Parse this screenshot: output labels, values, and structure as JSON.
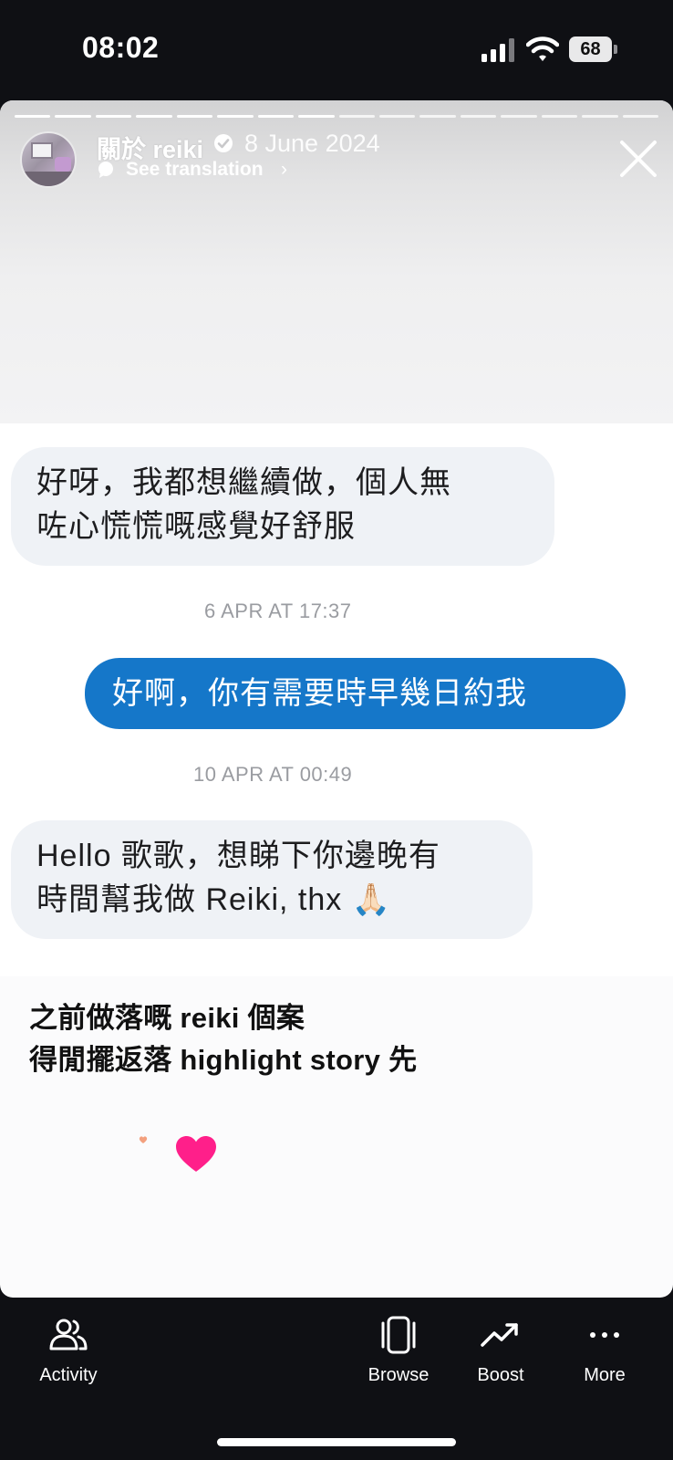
{
  "status_bar": {
    "time": "08:02",
    "battery": "68"
  },
  "story": {
    "account_name": "關於 reiki",
    "date": "8 June 2024",
    "see_translation": "See translation",
    "progress_total": 16,
    "progress_done": 8
  },
  "chat": {
    "messages": [
      {
        "direction": "incoming",
        "line1": "好呀，我都想繼續做，個人無",
        "line2": "咗心慌慌嘅感覺好舒服"
      },
      {
        "direction": "outgoing",
        "line1": "好啊，你有需要時早幾日約我"
      },
      {
        "direction": "incoming",
        "line1": "Hello 歌歌，想睇下你邊晚有",
        "line2": "時間幫我做 Reiki, thx 🙏🏻"
      }
    ],
    "timestamps": [
      "6 APR AT 17:37",
      "10 APR AT 00:49"
    ]
  },
  "caption": {
    "line1": "之前做落嘅 reiki 個案",
    "line2": "得閒擺返落 highlight story 先"
  },
  "bottom_nav": {
    "activity": "Activity",
    "browse": "Browse",
    "boost": "Boost",
    "more": "More"
  },
  "colors": {
    "outgoing_bubble": "#1577c9",
    "incoming_bubble": "#eff2f6",
    "heart": "#ff1f8a",
    "background": "#0f1014"
  },
  "icons": [
    "signal-icon",
    "wifi-icon",
    "battery-icon",
    "verified-icon",
    "translate-icon",
    "close-icon",
    "heart-icon",
    "activity-icon",
    "browse-icon",
    "boost-icon",
    "more-icon"
  ]
}
